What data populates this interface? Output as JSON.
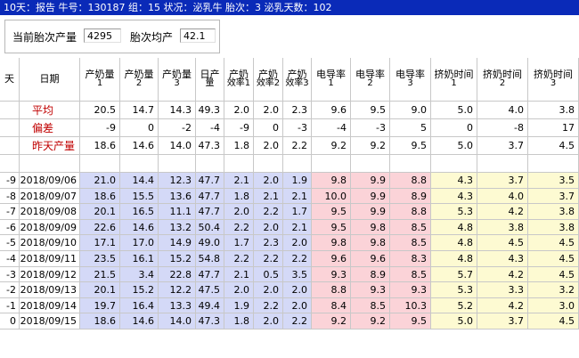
{
  "title_bar": {
    "text": "10天：报告  牛号：130187  组：15  状况：泌乳牛  胎次：3  泌乳天数：102"
  },
  "summary": {
    "current_parity_yield_label": "当前胎次产量",
    "current_parity_yield_value": "4295",
    "parity_avg_label": "胎次均产",
    "parity_avg_value": "42.1"
  },
  "columns": [
    {
      "line1": "天",
      "line2": ""
    },
    {
      "line1": "日期",
      "line2": ""
    },
    {
      "line1": "产奶量",
      "line2": "1"
    },
    {
      "line1": "产奶量",
      "line2": "2"
    },
    {
      "line1": "产奶量",
      "line2": "3"
    },
    {
      "line1": "日产",
      "line2": "量"
    },
    {
      "line1": "产奶",
      "line2": "效率1"
    },
    {
      "line1": "产奶",
      "line2": "效率2"
    },
    {
      "line1": "产奶",
      "line2": "效率3"
    },
    {
      "line1": "电导率",
      "line2": "1"
    },
    {
      "line1": "电导率",
      "line2": "2"
    },
    {
      "line1": "电导率",
      "line2": "3"
    },
    {
      "line1": "挤奶时间",
      "line2": "1"
    },
    {
      "line1": "挤奶时间",
      "line2": "2"
    },
    {
      "line1": "挤奶时间",
      "line2": "3"
    }
  ],
  "summary_rows": [
    {
      "label": "平均",
      "values": [
        "20.5",
        "14.7",
        "14.3",
        "49.3",
        "2.0",
        "2.0",
        "2.3",
        "9.6",
        "9.5",
        "9.0",
        "5.0",
        "4.0",
        "3.8"
      ]
    },
    {
      "label": "偏差",
      "values": [
        "-9",
        "0",
        "-2",
        "-4",
        "-9",
        "0",
        "-3",
        "-4",
        "-3",
        "5",
        "0",
        "-8",
        "17"
      ]
    },
    {
      "label": "昨天产量",
      "values": [
        "18.6",
        "14.6",
        "14.0",
        "47.3",
        "1.8",
        "2.0",
        "2.2",
        "9.2",
        "9.2",
        "9.5",
        "5.0",
        "3.7",
        "4.5"
      ]
    }
  ],
  "daily_rows": [
    {
      "day": "-9",
      "date": "2018/09/06",
      "values": [
        "21.0",
        "14.4",
        "12.3",
        "47.7",
        "2.1",
        "2.0",
        "1.9",
        "9.8",
        "9.9",
        "8.8",
        "4.3",
        "3.7",
        "3.5"
      ]
    },
    {
      "day": "-8",
      "date": "2018/09/07",
      "values": [
        "18.6",
        "15.5",
        "13.6",
        "47.7",
        "1.8",
        "2.1",
        "2.1",
        "10.0",
        "9.9",
        "8.9",
        "4.3",
        "4.0",
        "3.7"
      ]
    },
    {
      "day": "-7",
      "date": "2018/09/08",
      "values": [
        "20.1",
        "16.5",
        "11.1",
        "47.7",
        "2.0",
        "2.2",
        "1.7",
        "9.5",
        "9.9",
        "8.8",
        "5.3",
        "4.2",
        "3.8"
      ]
    },
    {
      "day": "-6",
      "date": "2018/09/09",
      "values": [
        "22.6",
        "14.6",
        "13.2",
        "50.4",
        "2.2",
        "2.0",
        "2.1",
        "9.5",
        "9.8",
        "8.5",
        "4.8",
        "3.8",
        "3.8"
      ]
    },
    {
      "day": "-5",
      "date": "2018/09/10",
      "values": [
        "17.1",
        "17.0",
        "14.9",
        "49.0",
        "1.7",
        "2.3",
        "2.0",
        "9.8",
        "9.8",
        "8.5",
        "4.8",
        "4.5",
        "4.5"
      ]
    },
    {
      "day": "-4",
      "date": "2018/09/11",
      "values": [
        "23.5",
        "16.1",
        "15.2",
        "54.8",
        "2.2",
        "2.2",
        "2.2",
        "9.6",
        "9.6",
        "8.3",
        "4.8",
        "4.3",
        "4.5"
      ]
    },
    {
      "day": "-3",
      "date": "2018/09/12",
      "values": [
        "21.5",
        "3.4",
        "22.8",
        "47.7",
        "2.1",
        "0.5",
        "3.5",
        "9.3",
        "8.9",
        "8.5",
        "5.7",
        "4.2",
        "4.5"
      ]
    },
    {
      "day": "-2",
      "date": "2018/09/13",
      "values": [
        "20.1",
        "15.2",
        "12.2",
        "47.5",
        "2.0",
        "2.0",
        "2.0",
        "8.8",
        "9.3",
        "9.3",
        "5.3",
        "3.3",
        "3.2"
      ]
    },
    {
      "day": "-1",
      "date": "2018/09/14",
      "values": [
        "19.7",
        "16.4",
        "13.3",
        "49.4",
        "1.9",
        "2.2",
        "2.0",
        "8.4",
        "8.5",
        "10.3",
        "5.2",
        "4.2",
        "3.0"
      ]
    },
    {
      "day": "0",
      "date": "2018/09/15",
      "values": [
        "18.6",
        "14.6",
        "14.0",
        "47.3",
        "1.8",
        "2.0",
        "2.2",
        "9.2",
        "9.2",
        "9.5",
        "5.0",
        "3.7",
        "4.5"
      ]
    }
  ],
  "colors": {
    "titlebar_bg": "#0a2ab8",
    "yield_bg": "#d4d9f7",
    "conductivity_bg": "#fbd3d8",
    "milking_time_bg": "#fdfad2",
    "summary_label_color": "#c00000"
  }
}
